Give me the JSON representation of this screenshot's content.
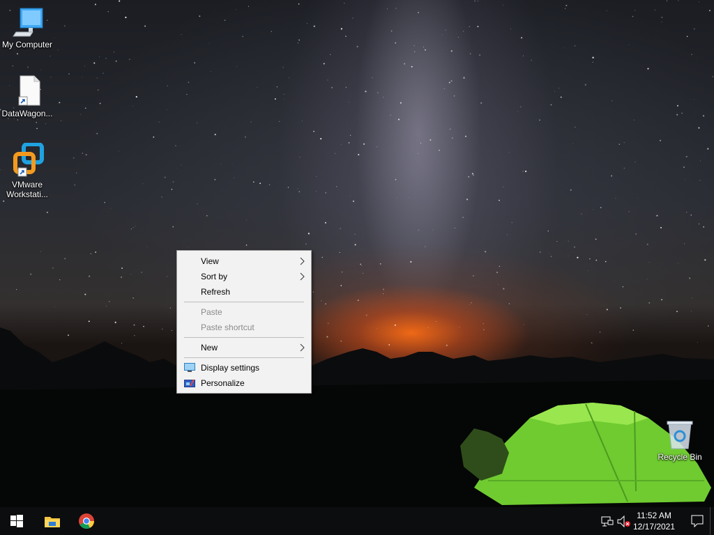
{
  "desktop": {
    "icons": [
      {
        "label": "My Computer",
        "icon": "computer-icon"
      },
      {
        "label": "DataWagon...",
        "icon": "document-shortcut-icon"
      },
      {
        "label": "VMware Workstati...",
        "icon": "vmware-icon"
      },
      {
        "label": "Recycle Bin",
        "icon": "recycle-bin-icon"
      }
    ]
  },
  "context_menu": {
    "view": "View",
    "sort_by": "Sort by",
    "refresh": "Refresh",
    "paste": "Paste",
    "paste_shortcut": "Paste shortcut",
    "new": "New",
    "display_settings": "Display settings",
    "personalize": "Personalize",
    "submenu_arrow": "chevron-right-icon"
  },
  "taskbar": {
    "start": "windows-logo-icon",
    "pinned": [
      "file-explorer-icon",
      "chrome-icon"
    ],
    "tray": [
      "network-icon",
      "volume-muted-icon"
    ],
    "time": "11:52 AM",
    "date": "12/17/2021",
    "notifications": "action-center-icon"
  },
  "colors": {
    "menu_bg": "#f2f2f2",
    "menu_disabled_text": "#8a8a8a",
    "taskbar_bg": "#0c0d0f",
    "tent_green": "#7bd53a"
  }
}
